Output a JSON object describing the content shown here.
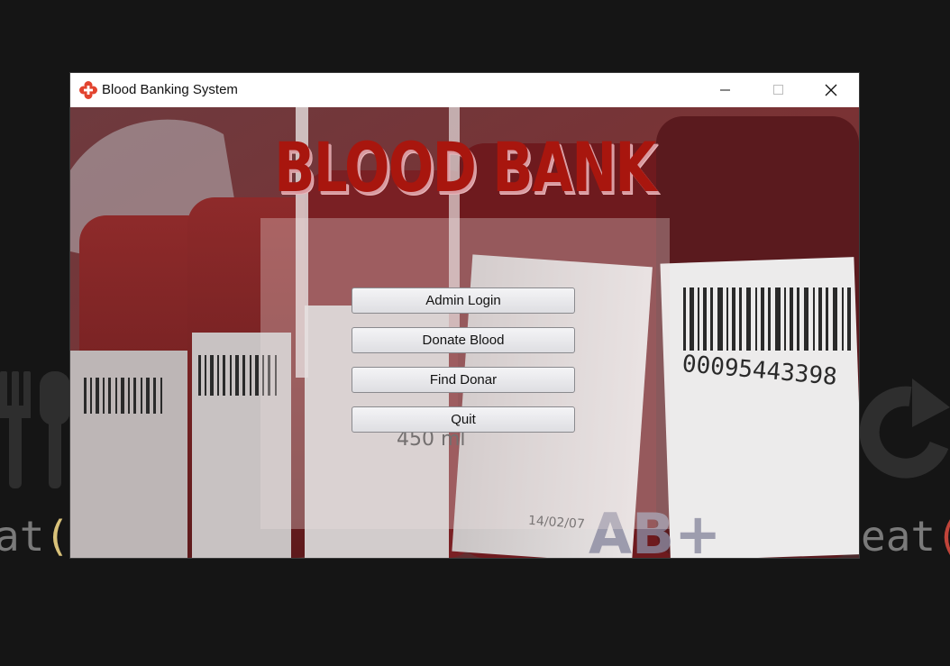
{
  "window": {
    "title": "Blood Banking System",
    "icon": "red-cross-icon",
    "controls": [
      "minimize-icon",
      "maximize-icon",
      "close-icon"
    ]
  },
  "banner": {
    "text": "BLOOD BANK"
  },
  "menu": {
    "buttons": [
      {
        "label": "Admin Login"
      },
      {
        "label": "Donate Blood"
      },
      {
        "label": "Find Donar"
      },
      {
        "label": "Quit"
      }
    ]
  },
  "background_photo": {
    "bag_labels": [
      "00095443398",
      "450 ml",
      "AB+",
      "14/02/07"
    ]
  },
  "desktop": {
    "code_left": "at()",
    "code_right": "eat("
  },
  "colors": {
    "banner_red": "#a8160e",
    "icon_red": "#e2442f"
  }
}
